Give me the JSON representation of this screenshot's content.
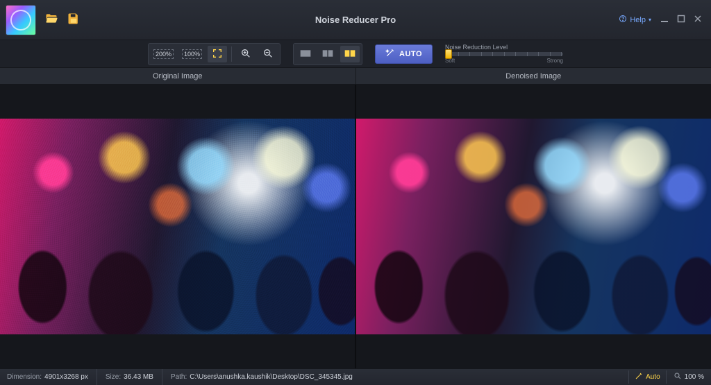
{
  "app": {
    "title": "Noise Reducer Pro",
    "help_label": "Help"
  },
  "toolbar": {
    "zoom_200": "200%",
    "zoom_100": "100%",
    "auto_label": "AUTO"
  },
  "slider": {
    "title": "Noise Reduction Level",
    "min_label": "Soft",
    "max_label": "Strong"
  },
  "compare": {
    "left_label": "Original Image",
    "right_label": "Denoised Image"
  },
  "status": {
    "dimension_label": "Dimension:",
    "dimension_value": "4901x3268 px",
    "size_label": "Size:",
    "size_value": "36.43 MB",
    "path_label": "Path:",
    "path_value": "C:\\Users\\anushka.kaushik\\Desktop\\DSC_345345.jpg",
    "auto_label": "Auto",
    "zoom_value": "100 %"
  }
}
